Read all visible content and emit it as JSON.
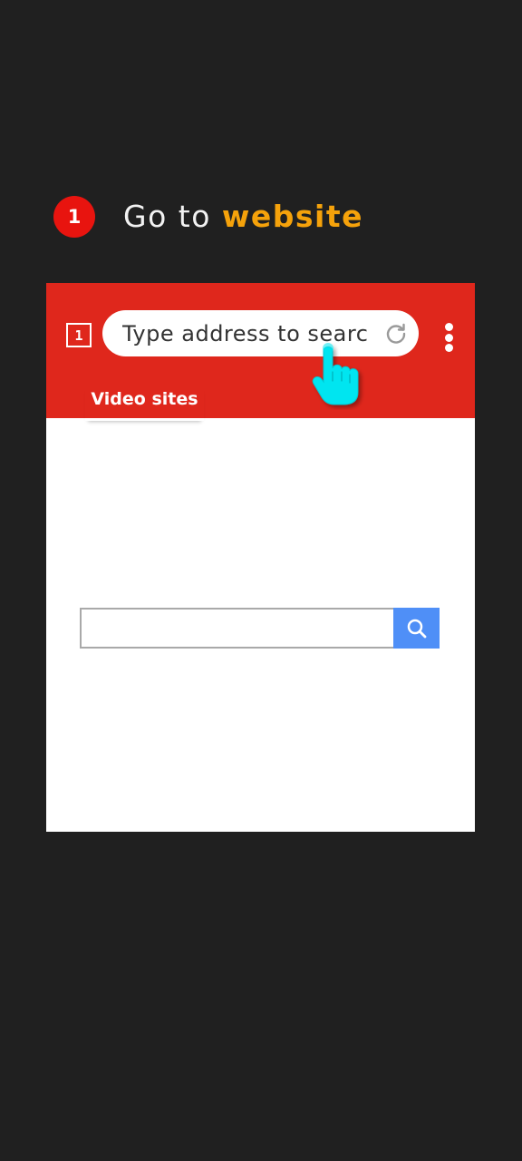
{
  "step": {
    "number": "1",
    "title_prefix": "Go to",
    "title_highlight": "website"
  },
  "browser": {
    "tab_count": "1",
    "address_bar": {
      "placeholder": "Type address to search"
    },
    "tabs": [
      {
        "label": "Video sites",
        "active": true
      }
    ]
  },
  "page": {
    "search_input": {
      "value": ""
    }
  },
  "colors": {
    "background": "#202020",
    "toolbar": "#df271c",
    "step_badge": "#e8140f",
    "highlight": "#f5a20b",
    "search_button": "#4f8ff7",
    "pointer": "#00e5f0"
  },
  "icons": {
    "reload": "reload-icon",
    "menu": "more-vertical-icon",
    "search": "search-icon",
    "pointer": "hand-pointer-icon"
  }
}
